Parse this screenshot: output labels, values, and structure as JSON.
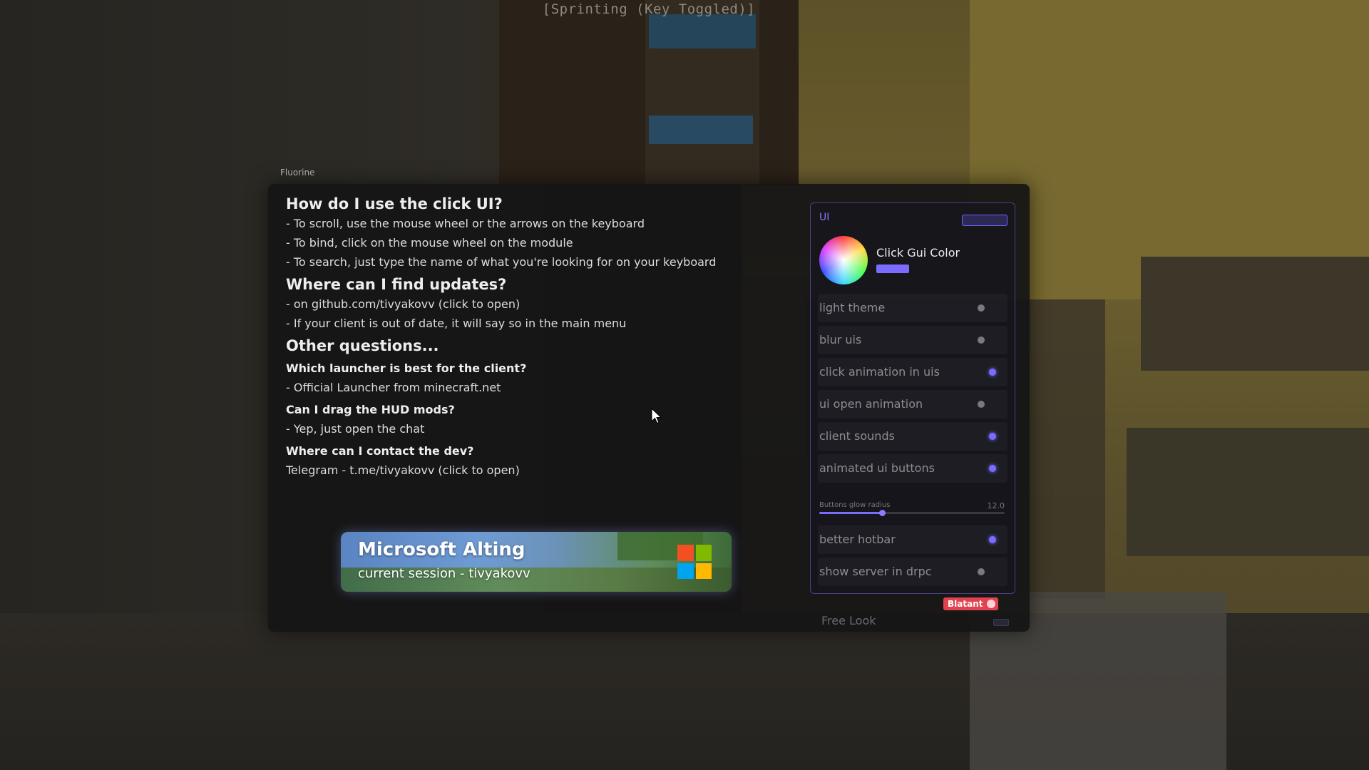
{
  "hud": {
    "sprint_text": "[Sprinting (Key Toggled)]"
  },
  "client": {
    "name": "Fluorine"
  },
  "help": {
    "sections": [
      {
        "heading": "How do I use the click UI?",
        "lines": [
          "- To scroll, use the mouse wheel or the arrows on the keyboard",
          "- To bind, click on the mouse wheel on the module",
          "- To search, just type the name of what you're looking for on your keyboard"
        ]
      },
      {
        "heading": "Where can I find updates?",
        "lines": [
          "- on github.com/tivyakovv (click to open)",
          "- If your client is out of date, it will say so in the main menu"
        ]
      },
      {
        "heading": "Other questions...",
        "lines": []
      }
    ],
    "faq": [
      {
        "q": "Which launcher is best for the client?",
        "a": "- Official Launcher from minecraft.net"
      },
      {
        "q": "Can I drag the HUD mods?",
        "a": "- Yep, just open the chat"
      },
      {
        "q": "Where can I contact the dev?",
        "a": "Telegram - t.me/tivyakovv (click to open)"
      }
    ]
  },
  "account": {
    "title": "Microsoft Alting",
    "session": "current session - tivyakovv",
    "logo_colors": [
      "#f25022",
      "#7fba00",
      "#00a4ef",
      "#ffb900"
    ]
  },
  "ui_module": {
    "title": "UI",
    "color_setting": {
      "label": "Click Gui Color",
      "value": "#7b6cff"
    },
    "settings": [
      {
        "label": "light theme",
        "enabled": false
      },
      {
        "label": "blur uis",
        "enabled": false
      },
      {
        "label": "click animation in uis",
        "enabled": true
      },
      {
        "label": "ui open animation",
        "enabled": false
      },
      {
        "label": "client sounds",
        "enabled": true
      },
      {
        "label": "animated ui buttons",
        "enabled": true
      }
    ],
    "slider": {
      "label": "Buttons glow radius",
      "value": "12.0",
      "fraction": 0.34
    },
    "settings_after": [
      {
        "label": "better hotbar",
        "enabled": true
      },
      {
        "label": "show server in drpc",
        "enabled": false
      }
    ]
  },
  "category_badge": {
    "label": "Blatant"
  },
  "next_module": {
    "label": "Free Look"
  },
  "colors": {
    "accent": "#7b6cff",
    "badge": "#e0424f"
  }
}
